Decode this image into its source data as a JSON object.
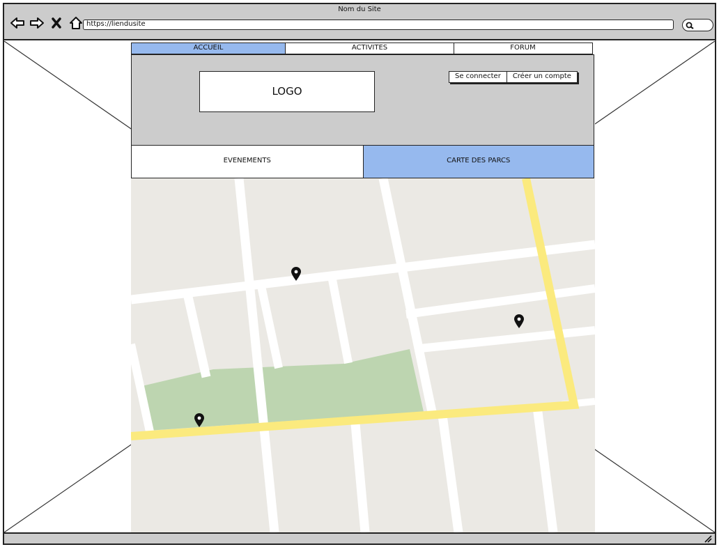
{
  "window": {
    "title": "Nom du Site"
  },
  "browser": {
    "url": "https://liendusite",
    "buttons": [
      {
        "icon": "back-icon"
      },
      {
        "icon": "forward-icon"
      },
      {
        "icon": "close-icon"
      },
      {
        "icon": "home-icon"
      }
    ],
    "search_icon": "search-icon"
  },
  "topnav": {
    "tabs": [
      {
        "label": "ACCUEIL",
        "active": true
      },
      {
        "label": "ACTIVITES",
        "active": false
      },
      {
        "label": "FORUM",
        "active": false
      }
    ]
  },
  "header": {
    "logo": "LOGO",
    "login_label": "Se connecter",
    "signup_label": "Créer un compte"
  },
  "subnav": {
    "tabs": [
      {
        "label": "EVENEMENTS",
        "active": false
      },
      {
        "label": "CARTE DES PARCS",
        "active": true
      }
    ]
  },
  "map": {
    "colors": {
      "ground": "#ebe9e4",
      "road": "#ffffff",
      "highway": "#fbea7e",
      "park": "#bdd5b0",
      "pin": "#111111"
    },
    "pins": [
      "map-pin-icon",
      "map-pin-icon",
      "map-pin-icon"
    ]
  },
  "colors": {
    "chrome": "#cccccc",
    "accent": "#96b9ee"
  }
}
